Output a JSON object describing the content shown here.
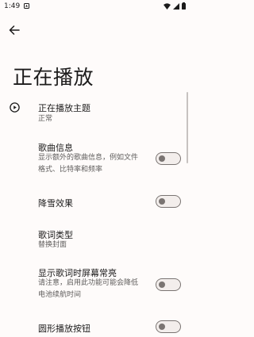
{
  "status_bar": {
    "time": "1:49"
  },
  "page": {
    "title": "正在播放"
  },
  "prefs": [
    {
      "title": "正在播放主题",
      "summary": "正常"
    },
    {
      "title": "歌曲信息",
      "summary_line1": "显示额外的歌曲信息，例如文件",
      "summary_line2": "格式、比特率和频率",
      "switch": false
    },
    {
      "title": "降雪效果",
      "switch": false
    },
    {
      "title": "歌词类型",
      "summary": "替换封面"
    },
    {
      "title": "显示歌词时屏幕常亮",
      "summary_line1": "请注意，启用此功能可能会降低",
      "summary_line2": "电池续航时间",
      "switch": false
    },
    {
      "title": "圆形播放按钮",
      "switch": false
    }
  ]
}
